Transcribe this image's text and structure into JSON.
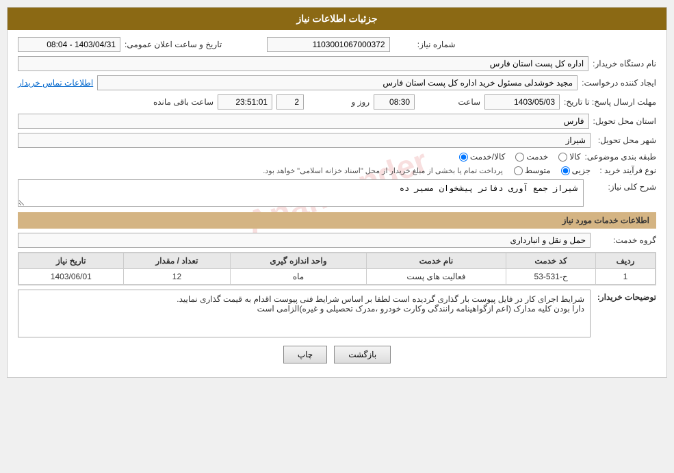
{
  "header": {
    "title": "جزئیات اطلاعات نیاز"
  },
  "fields": {
    "need_number_label": "شماره نیاز:",
    "need_number_value": "1103001067000372",
    "buyer_org_label": "نام دستگاه خریدار:",
    "buyer_org_value": "اداره کل پست استان فارس",
    "announcement_date_label": "تاریخ و ساعت اعلان عمومی:",
    "announcement_date_value": "1403/04/31 - 08:04",
    "creator_label": "ایجاد کننده درخواست:",
    "creator_value": "مجید خوشدلی مسئول خرید اداره کل پست استان فارس",
    "contact_info_link": "اطلاعات تماس خریدار",
    "response_deadline_label": "مهلت ارسال پاسخ: تا تاریخ:",
    "response_date_value": "1403/05/03",
    "response_time_label": "ساعت",
    "response_time_value": "08:30",
    "response_days_label": "روز و",
    "response_days_value": "2",
    "response_remaining_label": "ساعت باقی مانده",
    "response_remaining_value": "23:51:01",
    "province_label": "استان محل تحویل:",
    "province_value": "فارس",
    "city_label": "شهر محل تحویل:",
    "city_value": "شیراز",
    "category_label": "طبقه بندی موضوعی:",
    "category_options": [
      "کالا",
      "خدمت",
      "کالا/خدمت"
    ],
    "category_selected": "کالا",
    "purchase_type_label": "نوع فرآیند خرید :",
    "purchase_type_options": [
      "جزیی",
      "متوسط"
    ],
    "purchase_type_note": "پرداخت تمام یا بخشی از مبلغ خریدار از محل \"اسناد خزانه اسلامی\" خواهد بود.",
    "description_section_label": "شرح کلی نیاز:",
    "description_value": "شیراز جمع آوری دفاتر پیشخوان مسیر ده",
    "services_section_label": "اطلاعات خدمات مورد نیاز",
    "service_group_label": "گروه خدمت:",
    "service_group_value": "حمل و نقل و انبارداری",
    "table": {
      "headers": [
        "ردیف",
        "کد خدمت",
        "نام خدمت",
        "واحد اندازه گیری",
        "تعداد / مقدار",
        "تاریخ نیاز"
      ],
      "rows": [
        {
          "row": "1",
          "code": "ح-531-53",
          "name": "فعالیت های پست",
          "unit": "ماه",
          "quantity": "12",
          "date": "1403/06/01"
        }
      ]
    },
    "buyer_notes_label": "توضیحات خریدار:",
    "buyer_notes_value": "شرایط اجرای کار در فایل پیوست بار گذاری گردیده است لطفا بر اساس شرایط فنی پیوست اقدام به قیمت گذاری نمایید.\nدارا بودن کلیه مدارک (اعم ازگواهینامه رانندگی وکارت خودرو ،مدرک تحصیلی و غیره)الزامی است"
  },
  "buttons": {
    "back_label": "بازگشت",
    "print_label": "چاپ"
  }
}
